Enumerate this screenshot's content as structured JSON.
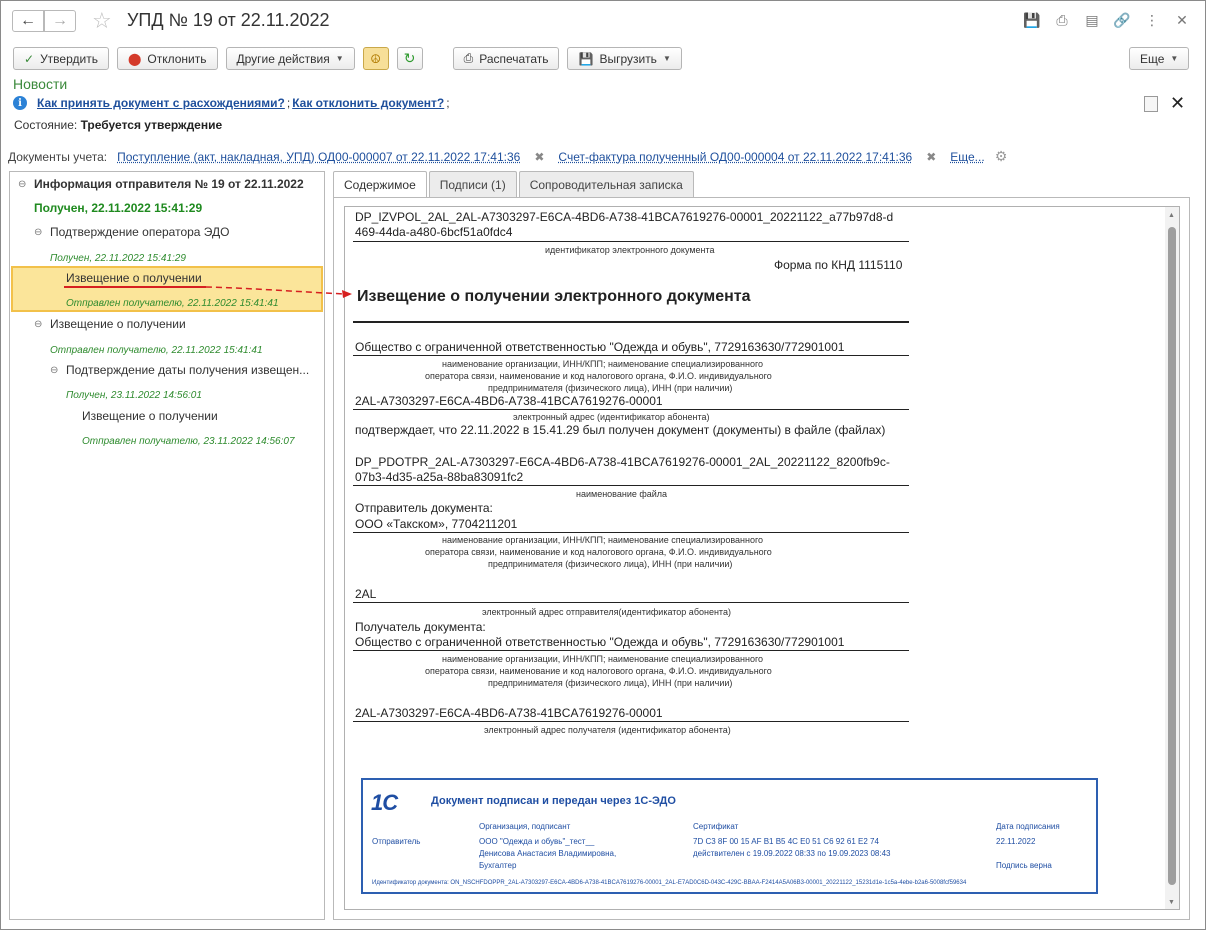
{
  "window": {
    "title": "УПД № 19 от 22.11.2022"
  },
  "toolbar": {
    "approve": "Утвердить",
    "reject": "Отклонить",
    "other_actions": "Другие действия",
    "print": "Распечатать",
    "export": "Выгрузить",
    "more": "Еще"
  },
  "news": "Новости",
  "info": {
    "link1": "Как принять документ с расхождениями?",
    "sep": ";",
    "link2": "Как отклонить документ?",
    "sep2": ";"
  },
  "state": {
    "label": "Состояние:",
    "value": "Требуется утверждение"
  },
  "accounting_docs": {
    "label": "Документы учета:",
    "doc1": "Поступление (акт, накладная, УПД) ОД00-000007 от 22.11.2022 17:41:36",
    "doc2": "Счет-фактура полученный ОД00-000004 от 22.11.2022 17:41:36",
    "more": "Еще..."
  },
  "tree": [
    {
      "label": "Информация отправителя № 19 от 22.11.2022",
      "sub": "Получен, 22.11.2022 15:41:29"
    },
    {
      "label": "Подтверждение оператора ЭДО",
      "sub": "Получен, 22.11.2022 15:41:29"
    },
    {
      "label": "Извещение о получении",
      "sub": "Отправлен получателю, 22.11.2022 15:41:41"
    },
    {
      "label": "Извещение о получении",
      "sub": "Отправлен получателю, 22.11.2022 15:41:41"
    },
    {
      "label": "Подтверждение даты получения извещен...",
      "sub": "Получен, 23.11.2022 14:56:01"
    },
    {
      "label": "Извещение о получении",
      "sub": "Отправлен получателю, 23.11.2022 14:56:07"
    }
  ],
  "tabs": [
    "Содержимое",
    "Подписи (1)",
    "Сопроводительная записка"
  ],
  "document": {
    "id_line1": "DP_IZVPOL_2AL_2AL-A7303297-E6CA-4BD6-A738-41BCA7619276-00001_20221122_a77b97d8-d",
    "id_line2": "469-44da-a480-6bcf51a0fdc4",
    "id_caption": "идентификатор электронного документа",
    "form": "Форма по КНД 1115110",
    "heading": "Извещение о получении электронного документа",
    "org": "Общество с ограниченной ответственностью \"Одежда и обувь\", 7729163630/772901001",
    "org_cap1": "наименование организации, ИНН/КПП; наименование специализированного",
    "org_cap2": "оператора связи, наименование и код налогового органа, Ф.И.О. индивидуального",
    "org_cap3": "предпринимателя (физического лица), ИНН (при наличии)",
    "addr": "2AL-A7303297-E6CA-4BD6-A738-41BCA7619276-00001",
    "addr_cap": "электронный адрес (идентификатор абонента)",
    "confirms": "подтверждает, что 22.11.2022 в 15.41.29 был получен документ (документы) в файле (файлах)",
    "file1": "DP_PDOTPR_2AL-A7303297-E6CA-4BD6-A738-41BCA7619276-00001_2AL_20221122_8200fb9c-",
    "file2": "07b3-4d35-a25a-88ba83091fc2",
    "file_cap": "наименование файла",
    "sender_label": "Отправитель документа:",
    "sender": "ООО «Такском», 7704211201",
    "sender_cap1": "наименование организации, ИНН/КПП; наименование специализированного",
    "sender_cap2": "оператора связи, наименование и код налогового органа, Ф.И.О. индивидуального",
    "sender_cap3": "предпринимателя (физического лица), ИНН (при наличии)",
    "sender_addr": "2AL",
    "sender_addr_cap": "электронный адрес отправителя(идентификатор абонента)",
    "recipient_label": "Получатель документа:",
    "recipient": "Общество с ограниченной ответственностью \"Одежда и обувь\", 7729163630/772901001",
    "rec_cap1": "наименование организации, ИНН/КПП; наименование специализированного",
    "rec_cap2": "оператора связи, наименование и код налогового органа, Ф.И.О. индивидуального",
    "rec_cap3": "предпринимателя (физического лица), ИНН (при наличии)",
    "rec_addr": "2AL-A7303297-E6CA-4BD6-A738-41BCA7619276-00001",
    "rec_addr_cap": "электронный адрес получателя (идентификатор абонента)"
  },
  "stamp": {
    "logo": "1С",
    "title": "Документ подписан и передан через 1С-ЭДО",
    "col_org": "Организация, подписант",
    "col_cert": "Сертификат",
    "col_date": "Дата подписания",
    "row_label": "Отправитель",
    "org1": "ООО \"Одежда и обувь\"_тест__",
    "org2": "Денисова Анастасия Владимировна,",
    "org3": "Бухгалтер",
    "cert1": "7D C3 8F 00 15 AF B1 B5 4C E0 51 C6 92 61 E2 74",
    "cert2": "действителен с 19.09.2022 08:33 по 19.09.2023 08:43",
    "date": "22.11.2022",
    "sig_ok": "Подпись верна",
    "footer": "Идентификатор документа: ON_NSCHFDOPPR_2AL-A7303297-E6CA-4BD6-A738-41BCA7619276-00001_2AL-E7AD0C6D-043C-429C-BBAA-F2414A5A06B3-00001_20221122_15231d1e-1c5a-4ebe-b2a6-5008fcf59634"
  }
}
